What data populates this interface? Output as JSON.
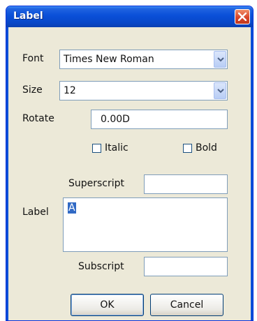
{
  "window": {
    "title": "Label"
  },
  "form": {
    "font_label": "Font",
    "font_value": "Times New Roman",
    "size_label": "Size",
    "size_value": "12",
    "rotate_label": "Rotate",
    "rotate_value": "0.00D",
    "italic_label": "Italic",
    "italic_checked": false,
    "bold_label": "Bold",
    "bold_checked": false,
    "superscript_label": "Superscript",
    "superscript_value": "",
    "label_label": "Label",
    "label_value": "A",
    "subscript_label": "Subscript",
    "subscript_value": ""
  },
  "buttons": {
    "ok": "OK",
    "cancel": "Cancel"
  },
  "icons": {
    "close": "close-icon",
    "dropdown": "chevron-down-icon"
  },
  "colors": {
    "titlebar": "#0a4fd8",
    "close": "#d9452a",
    "dialog_bg": "#ece9d8",
    "selection": "#316ac5"
  }
}
